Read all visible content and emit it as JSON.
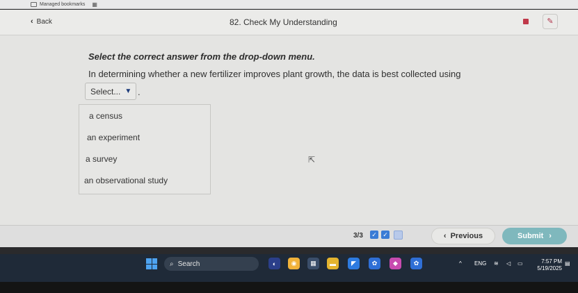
{
  "browser": {
    "bookmarks_label": "Managed bookmarks"
  },
  "header": {
    "back_label": "Back",
    "title": "82. Check My Understanding"
  },
  "question": {
    "instruction": "Select the correct answer from the drop-down menu.",
    "text": "In determining whether a new fertilizer improves plant growth, the data is best collected using",
    "select_value": "Select...",
    "trailing": ".",
    "options": [
      "a census",
      "an experiment",
      "a survey",
      "an observational study"
    ]
  },
  "footer": {
    "progress": "3/3",
    "previous_label": "Previous",
    "submit_label": "Submit"
  },
  "taskbar": {
    "search_label": "Search",
    "language": "ENG",
    "time": "7:57 PM",
    "date": "5/19/2025"
  },
  "colors": {
    "submit": "#7fb8bd",
    "accent": "#3a7bd5",
    "taskbar": "#1f2a38"
  },
  "icons": [
    "chevron-left-icon",
    "caret-down-icon",
    "checkbox-icon",
    "windows-start-icon",
    "search-icon",
    "wifi-icon",
    "speaker-icon",
    "battery-icon"
  ]
}
